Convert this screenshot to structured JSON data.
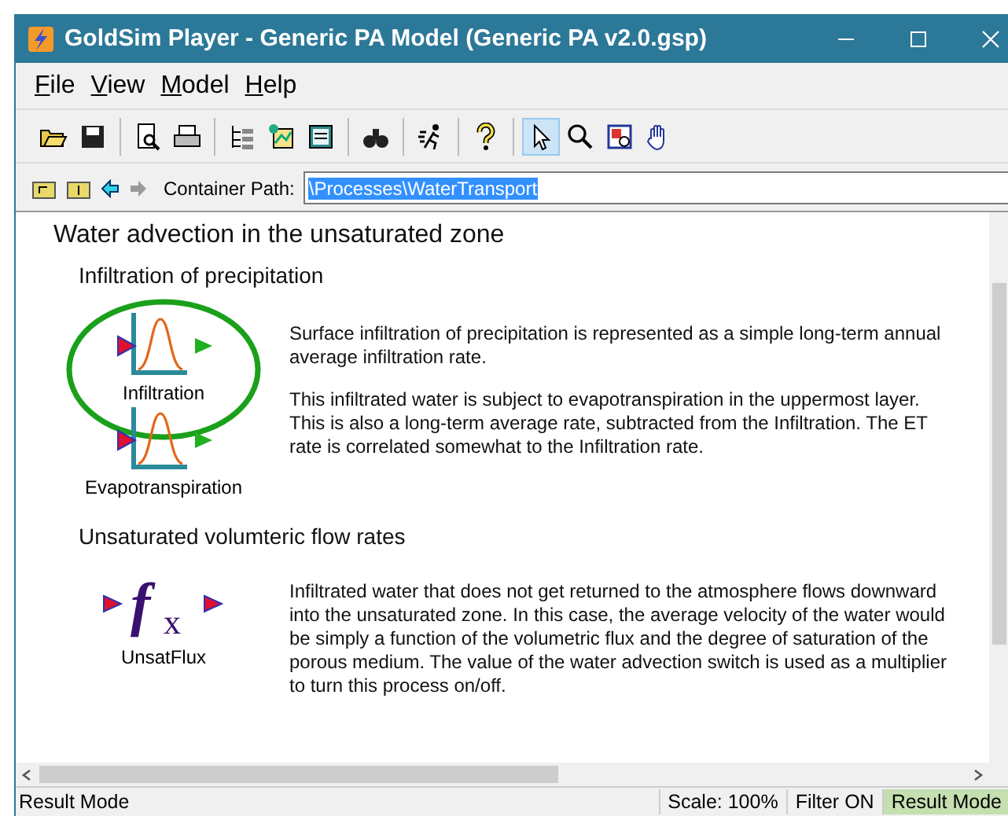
{
  "window": {
    "title": "GoldSim Player - Generic PA Model (Generic PA v2.0.gsp)"
  },
  "menu": [
    "File",
    "View",
    "Model",
    "Help"
  ],
  "toolbar": [
    [
      {
        "kind": "open",
        "selected": false
      },
      {
        "kind": "save",
        "selected": false
      }
    ],
    [
      {
        "kind": "preview",
        "selected": false
      },
      {
        "kind": "print",
        "selected": false
      }
    ],
    [
      {
        "kind": "tree",
        "selected": false
      },
      {
        "kind": "graph",
        "selected": false
      },
      {
        "kind": "browser",
        "selected": false
      }
    ],
    [
      {
        "kind": "find",
        "selected": false
      }
    ],
    [
      {
        "kind": "run",
        "selected": false
      }
    ],
    [
      {
        "kind": "help",
        "selected": false
      }
    ],
    [
      {
        "kind": "pointer",
        "selected": true
      },
      {
        "kind": "zoom",
        "selected": false
      },
      {
        "kind": "zoombox",
        "selected": false
      },
      {
        "kind": "pan",
        "selected": false
      }
    ]
  ],
  "path_bar": {
    "label": "Container Path:",
    "value": "\\Processes\\WaterTransport"
  },
  "content": {
    "heading": "Water advection in the unsaturated zone",
    "sections": [
      {
        "title": "Infiltration of precipitation",
        "elements": [
          {
            "label": "Infiltration",
            "kind": "distribution",
            "circled": true
          },
          {
            "label": "Evapotranspiration",
            "kind": "distribution",
            "circled": false
          }
        ],
        "paragraphs": [
          "Surface infiltration of precipitation is represented as a simple long-term annual average infiltration rate.",
          "This infiltrated water is subject to evapotranspiration in the uppermost layer. This is also a long-term average rate, subtracted from the Infiltration. The ET rate is correlated somewhat to the Infiltration rate."
        ]
      },
      {
        "title": "Unsaturated volumteric flow rates",
        "elements": [
          {
            "label": "UnsatFlux",
            "kind": "function",
            "circled": false,
            "symbol": [
              "f",
              "x"
            ]
          }
        ],
        "paragraphs": [
          "Infiltrated water that does not get returned to the atmosphere flows downward into the unsaturated zone.  In this case, the average velocity of the water would be simply a function of the volumetric flux and the degree of saturation of the porous medium. The value of the water advection switch is used as a multiplier to turn this process on/off."
        ]
      }
    ]
  },
  "status_bar": {
    "text": "Result Mode",
    "panes": [
      {
        "text": "Scale: 100%",
        "highlighted": false
      },
      {
        "text": "Filter ON",
        "highlighted": false
      },
      {
        "text": "Result Mode",
        "highlighted": true
      }
    ]
  }
}
